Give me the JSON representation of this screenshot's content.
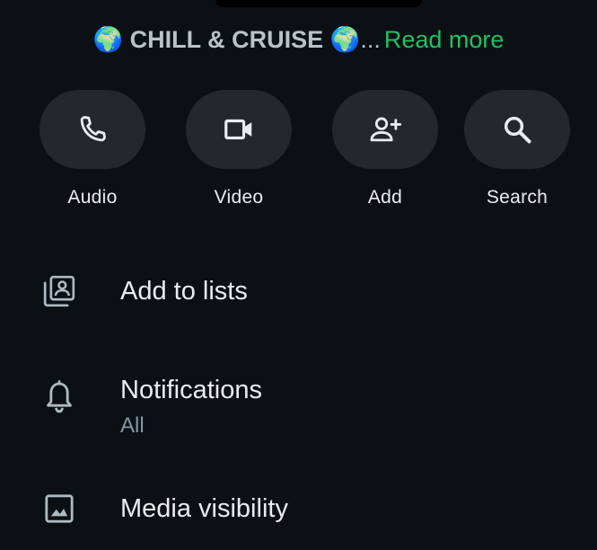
{
  "header": {
    "description_text": "🌍 CHILL & CRUISE 🌍",
    "ellipsis": "...",
    "read_more": "Read more"
  },
  "actions": [
    {
      "label": "Audio",
      "icon": "phone-icon"
    },
    {
      "label": "Video",
      "icon": "videocam-icon"
    },
    {
      "label": "Add",
      "icon": "add-person-icon"
    },
    {
      "label": "Search",
      "icon": "search-icon"
    }
  ],
  "menu": {
    "add_to_lists": {
      "title": "Add to lists",
      "icon": "add-to-lists-icon"
    },
    "notifications": {
      "title": "Notifications",
      "subtitle": "All",
      "icon": "bell-icon"
    },
    "media_visibility": {
      "title": "Media visibility",
      "icon": "image-icon"
    }
  },
  "colors": {
    "background": "#0b1014",
    "button_background": "#23282c",
    "accent_green": "#21c063",
    "primary_text": "#e9edef",
    "secondary_text": "#8696a0",
    "icon_color": "#aebac1"
  }
}
